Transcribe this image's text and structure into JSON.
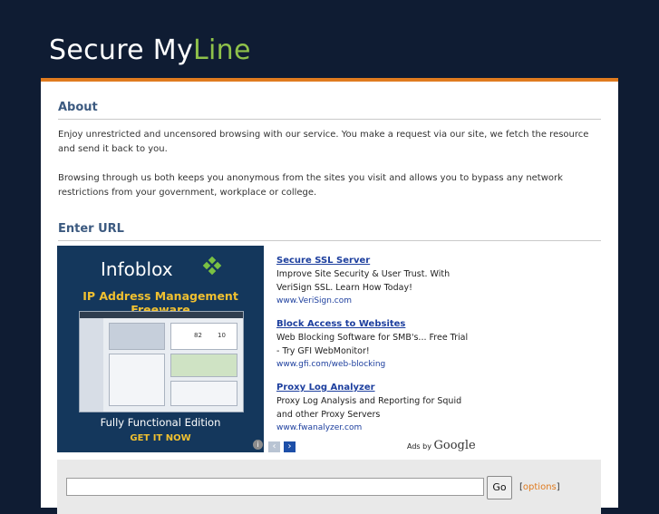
{
  "site": {
    "title_a": "Secure My",
    "title_b": "Line"
  },
  "about": {
    "heading": "About",
    "p1": "Enjoy unrestricted and uncensored browsing with our service. You make a request via our site, we fetch the resource and send it back to you.",
    "p2": "Browsing through us both keeps you anonymous from the sites you visit and allows you to bypass any network restrictions from your government, workplace or college."
  },
  "enter_url": {
    "heading": "Enter URL"
  },
  "banner": {
    "logo": "Infoblox",
    "title": "IP Address Management Freeware",
    "screen_num_a": "82",
    "screen_num_b": "10",
    "subtitle": "Fully Functional Edition",
    "cta": "GET IT NOW"
  },
  "ads": [
    {
      "title": "Secure SSL Server",
      "line1": "Improve Site Security & User Trust. With",
      "line2": "VeriSign SSL. Learn How Today!",
      "url": "www.VeriSign.com"
    },
    {
      "title": "Block Access to Websites",
      "line1": "Web Blocking Software for SMB's... Free Trial",
      "line2": "- Try GFI WebMonitor!",
      "url": "www.gfi.com/web-blocking"
    },
    {
      "title": "Proxy Log Analyzer",
      "line1": "Proxy Log Analysis and Reporting for Squid",
      "line2": "and other Proxy Servers",
      "url": "www.fwanalyzer.com"
    }
  ],
  "ads_by": {
    "label": "Ads by",
    "brand": "Google"
  },
  "form": {
    "url_value": "",
    "go_label": "Go",
    "options_open": "[",
    "options_label": "options",
    "options_close": "]"
  },
  "colors": {
    "background": "#0f1c33",
    "accent_orange": "#e07b1f",
    "accent_green": "#8fc14a",
    "heading_blue": "#3c5a80"
  }
}
